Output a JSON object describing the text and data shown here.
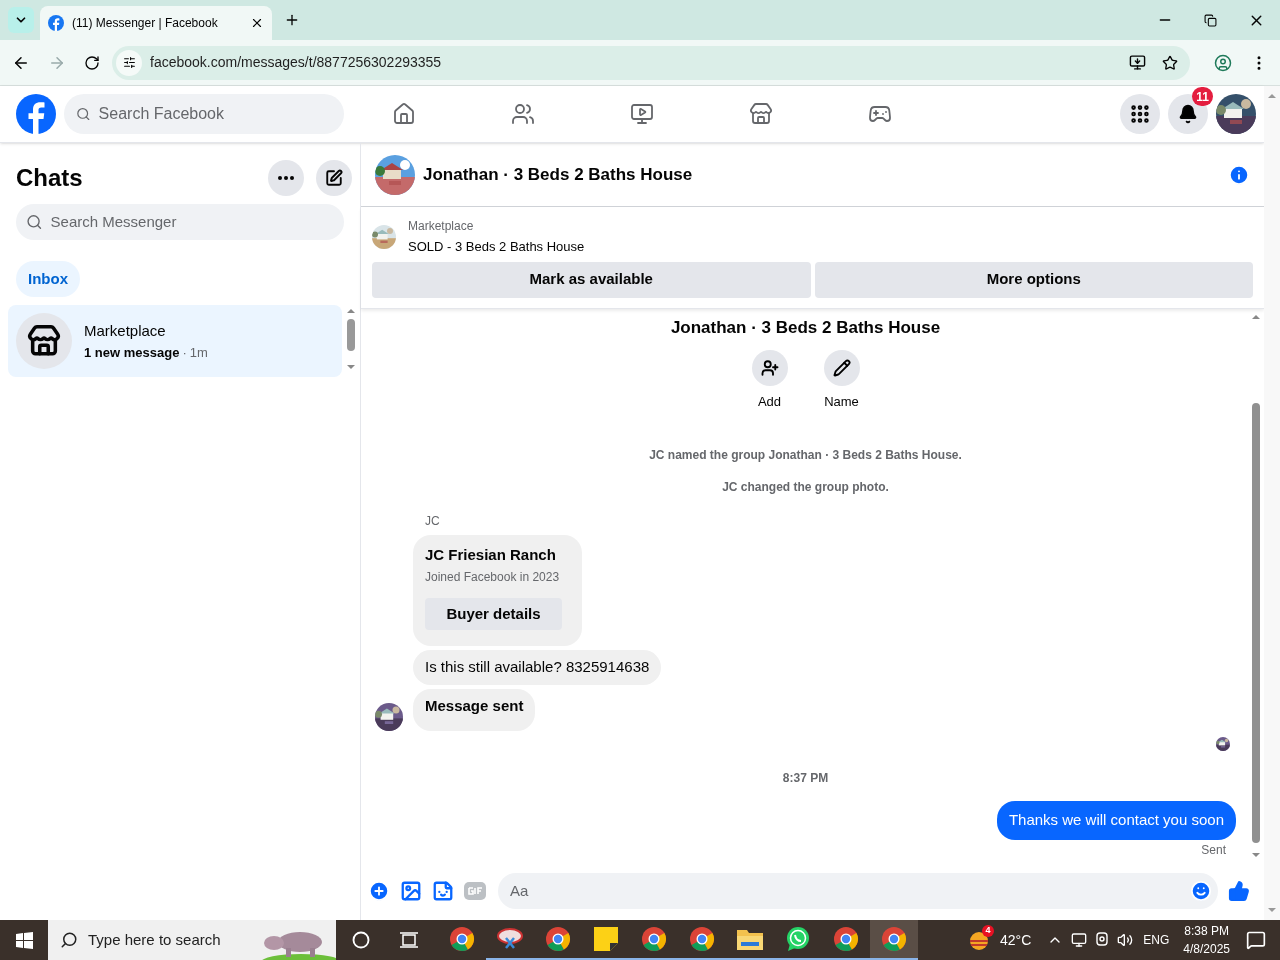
{
  "browser": {
    "tab_title": "(11) Messenger | Facebook",
    "url": "facebook.com/messages/t/8877256302293355"
  },
  "facebook_nav": {
    "search_placeholder": "Search Facebook",
    "nav_items": [
      {
        "kind": "home"
      },
      {
        "kind": "friends"
      },
      {
        "kind": "video"
      },
      {
        "kind": "store"
      },
      {
        "kind": "gaming"
      }
    ],
    "notification_count": "11"
  },
  "chats": {
    "title": "Chats",
    "search_placeholder": "Search Messenger",
    "filters": [
      {
        "label": "Inbox",
        "selected": true
      }
    ],
    "conversations": [
      {
        "name": "Marketplace",
        "preview": "1 new message",
        "separator": "·",
        "time": "1m",
        "selected": true,
        "unread": true
      }
    ]
  },
  "conversation": {
    "title": "Jonathan · 3 Beds 2 Baths House",
    "listing": {
      "source": "Marketplace",
      "title": "SOLD - 3 Beds 2 Baths House",
      "actions": [
        "Mark as available",
        "More options"
      ]
    },
    "group_name": "Jonathan · 3 Beds 2 Baths House",
    "group_actions": [
      {
        "kind": "add",
        "label": "Add"
      },
      {
        "kind": "name",
        "label": "Name"
      }
    ],
    "events": [
      "JC named the group Jonathan · 3 Beds 2 Baths House.",
      "JC changed the group photo."
    ],
    "sender": "JC",
    "profile_card": {
      "name": "JC Friesian Ranch",
      "subtitle": "Joined Facebook in 2023",
      "button": "Buyer details"
    },
    "messages": [
      {
        "kind": "incoming",
        "text": "Is this still available? 8325914638",
        "bold": false
      },
      {
        "kind": "incoming",
        "text": "Message sent",
        "bold": true
      }
    ],
    "timestamp": "8:37 PM",
    "outgoing": {
      "text": "Thanks we will contact you soon",
      "status": "Sent"
    },
    "composer_placeholder": "Aa"
  },
  "taskbar": {
    "search_placeholder": "Type here to search",
    "apps": [
      {
        "kind": "chrome",
        "running": false,
        "selected": false
      },
      {
        "kind": "snip",
        "running": true,
        "selected": false
      },
      {
        "kind": "chrome",
        "running": true,
        "selected": false
      },
      {
        "kind": "sticky",
        "running": true,
        "selected": false
      },
      {
        "kind": "chrome",
        "running": true,
        "selected": false
      },
      {
        "kind": "chrome",
        "running": true,
        "selected": false
      },
      {
        "kind": "folder",
        "running": true,
        "selected": false
      },
      {
        "kind": "whatsapp",
        "running": true,
        "selected": false
      },
      {
        "kind": "chrome",
        "running": true,
        "selected": false
      },
      {
        "kind": "chrome",
        "running": true,
        "selected": true
      }
    ],
    "weather_badge": "4",
    "temperature": "42°C",
    "language": "ENG",
    "time": "8:38 PM",
    "date": "4/8/2025"
  }
}
